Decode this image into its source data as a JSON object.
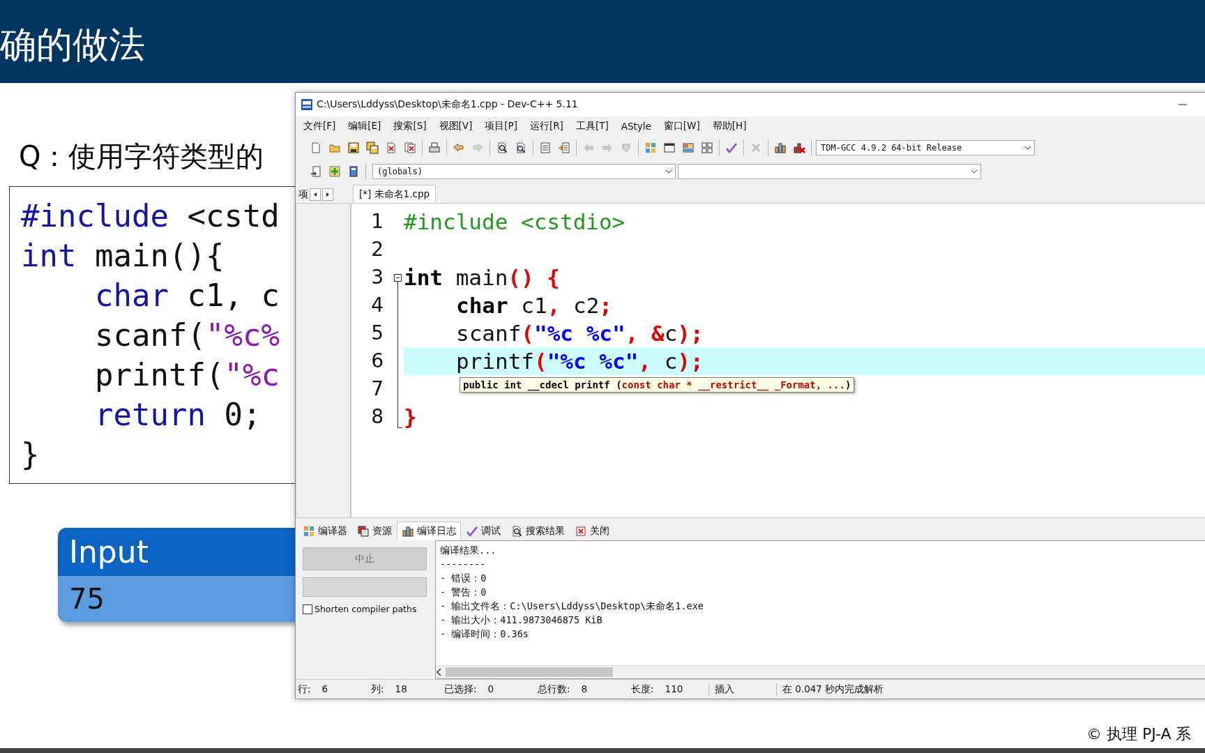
{
  "slide": {
    "title": "确的做法",
    "question": "Q：使用字符类型的",
    "code_lines": [
      {
        "indented": false,
        "tokens": [
          {
            "kind": "keyword",
            "text": "#include"
          },
          {
            "kind": "plain",
            "text": " <cstd"
          }
        ]
      },
      {
        "indented": false,
        "tokens": [
          {
            "kind": "keyword",
            "text": "int"
          },
          {
            "kind": "plain",
            "text": " main(){"
          }
        ]
      },
      {
        "indented": true,
        "tokens": [
          {
            "kind": "keyword",
            "text": "char"
          },
          {
            "kind": "plain",
            "text": " c1, c"
          }
        ]
      },
      {
        "indented": true,
        "tokens": [
          {
            "kind": "plain",
            "text": "scanf("
          },
          {
            "kind": "string",
            "text": "\"%c%"
          }
        ]
      },
      {
        "indented": true,
        "tokens": [
          {
            "kind": "plain",
            "text": "printf("
          },
          {
            "kind": "string",
            "text": "\"%c"
          }
        ]
      },
      {
        "indented": true,
        "tokens": [
          {
            "kind": "keyword",
            "text": "return"
          },
          {
            "kind": "plain",
            "text": " 0;"
          }
        ]
      },
      {
        "indented": false,
        "tokens": [
          {
            "kind": "plain",
            "text": "}"
          }
        ]
      }
    ],
    "input_box": {
      "header": "Input",
      "value": "75"
    },
    "footer": "© 执理 PJ-A 系"
  },
  "ide": {
    "title": "C:\\Users\\Lddyss\\Desktop\\未命名1.cpp - Dev-C++ 5.11",
    "menu": [
      "文件[F]",
      "编辑[E]",
      "搜索[S]",
      "视图[V]",
      "项目[P]",
      "运行[R]",
      "工具[T]",
      "AStyle",
      "窗口[W]",
      "帮助[H]"
    ],
    "toolbar_1": [
      {
        "buttons": [
          {
            "disabled": false
          },
          {
            "disabled": false
          },
          {
            "disabled": false
          },
          {
            "disabled": false
          },
          {
            "disabled": false
          },
          {
            "disabled": false
          }
        ]
      },
      {
        "buttons": [
          {
            "disabled": false
          }
        ]
      },
      {
        "buttons": [
          {
            "disabled": false
          },
          {
            "disabled": true
          }
        ]
      },
      {
        "buttons": [
          {
            "disabled": false
          },
          {
            "disabled": false
          }
        ]
      },
      {
        "buttons": [
          {
            "disabled": false
          },
          {
            "disabled": false
          }
        ]
      },
      {
        "buttons": [
          {
            "disabled": true
          },
          {
            "disabled": true
          },
          {
            "disabled": true
          }
        ]
      },
      {
        "buttons": [
          {
            "disabled": false
          },
          {
            "disabled": false
          },
          {
            "disabled": false
          },
          {
            "disabled": false
          }
        ]
      },
      {
        "buttons": [
          {
            "disabled": false
          }
        ]
      },
      {
        "buttons": [
          {
            "disabled": true
          }
        ]
      },
      {
        "buttons": [
          {
            "disabled": false
          },
          {
            "disabled": false
          }
        ]
      }
    ],
    "compiler_select": "TDM-GCC 4.9.2 64-bit Release",
    "toolbar_2": [
      {
        "disabled": false
      },
      {
        "disabled": false
      },
      {
        "disabled": false
      }
    ],
    "scope_select": "(globals)",
    "project_tab": "项",
    "file_tabs": [
      {
        "label": "[*] 未命名1.cpp",
        "selected": true
      }
    ],
    "editor": {
      "lines": [
        {
          "number": "1",
          "current": false,
          "collapsible": false,
          "indented": false,
          "tokens": [
            {
              "kind": "preproc",
              "text": "#include <cstdio>"
            }
          ]
        },
        {
          "number": "2",
          "current": false,
          "collapsible": false
        },
        {
          "number": "3",
          "current": false,
          "collapsible": true,
          "indented": false,
          "tokens": [
            {
              "kind": "keyword",
              "text": "int"
            },
            {
              "kind": "plain",
              "text": " main"
            },
            {
              "kind": "symbol",
              "text": "() {"
            }
          ]
        },
        {
          "number": "4",
          "current": false,
          "collapsible": false,
          "indented": true,
          "tokens": [
            {
              "kind": "keyword",
              "text": "char"
            },
            {
              "kind": "plain",
              "text": " c1"
            },
            {
              "kind": "symbol",
              "text": ","
            },
            {
              "kind": "plain",
              "text": " c2"
            },
            {
              "kind": "symbol",
              "text": ";"
            }
          ]
        },
        {
          "number": "5",
          "current": false,
          "collapsible": false,
          "indented": true,
          "tokens": [
            {
              "kind": "plain",
              "text": "scanf"
            },
            {
              "kind": "symbol",
              "text": "("
            },
            {
              "kind": "string",
              "text": "\"%c %c\""
            },
            {
              "kind": "symbol",
              "text": ", &"
            },
            {
              "kind": "plain",
              "text": "c"
            },
            {
              "kind": "symbol",
              "text": ");"
            }
          ]
        },
        {
          "number": "6",
          "current": true,
          "collapsible": false,
          "indented": true,
          "tokens": [
            {
              "kind": "plain",
              "text": "printf"
            },
            {
              "kind": "symbol",
              "text": "("
            },
            {
              "kind": "string",
              "text": "\"%c %c\""
            },
            {
              "kind": "symbol",
              "text": ","
            },
            {
              "kind": "plain",
              "text": " c"
            },
            {
              "kind": "symbol",
              "text": ");"
            }
          ]
        },
        {
          "number": "7",
          "current": false,
          "collapsible": false
        },
        {
          "number": "8",
          "current": false,
          "collapsible": false,
          "indented": false,
          "tokens": [
            {
              "kind": "symbol",
              "text": "}"
            }
          ]
        }
      ]
    },
    "tooltip": [
      {
        "kind": "plain",
        "text": "public int __cdecl printf ("
      },
      {
        "kind": "param",
        "text": "const char * __restrict__ _Format, ..."
      },
      {
        "kind": "plain",
        "text": ")"
      }
    ],
    "bottom_tabs": [
      {
        "label": "编译器",
        "selected": false
      },
      {
        "label": "资源",
        "selected": false
      },
      {
        "label": "编译日志",
        "selected": true
      },
      {
        "label": "调试",
        "selected": false
      },
      {
        "label": "搜索结果",
        "selected": false
      },
      {
        "label": "关闭",
        "selected": false
      }
    ],
    "stop_button": {
      "label": "中止",
      "disabled": true
    },
    "shorten_paths": {
      "label": "Shorten compiler paths",
      "checked": false
    },
    "log_lines": [
      "编译结果...",
      "--------",
      "- 错误：0",
      "- 警告：0",
      "- 输出文件名：C:\\Users\\Lddyss\\Desktop\\未命名1.exe",
      "- 输出大小：411.9873046875 KiB",
      "- 编译时间：0.36s"
    ],
    "status_bar": [
      {
        "label": "行:",
        "value": "6"
      },
      {
        "label": "列:",
        "value": "18"
      },
      {
        "label": "已选择:",
        "value": "0"
      },
      {
        "label": "总行数:",
        "value": "8"
      },
      {
        "label": "长度:",
        "value": "110"
      },
      {
        "label": "插入"
      },
      {
        "label": "在 0.047 秒内完成解析"
      }
    ]
  }
}
